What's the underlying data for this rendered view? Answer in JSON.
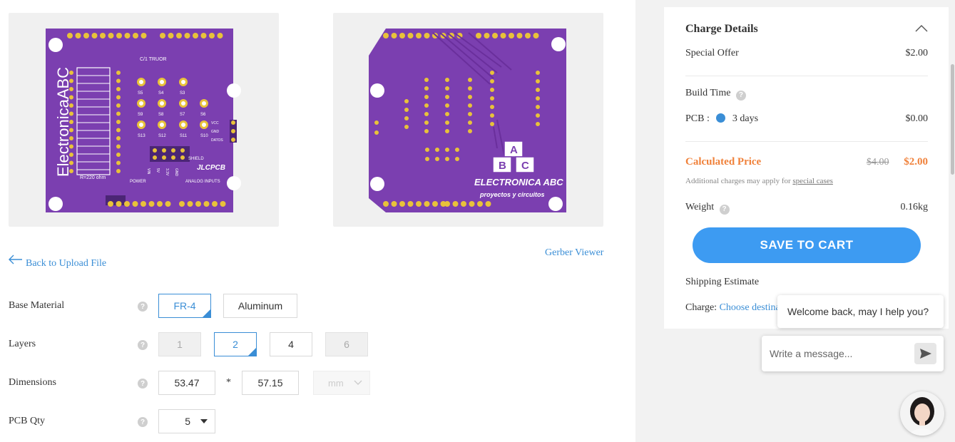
{
  "previews": {
    "top": {
      "label_vertical": "ElectronicaABC",
      "silkscreen_top": "C/1 TRUOR",
      "switch_labels": [
        "S5",
        "S4",
        "S3",
        "S9",
        "S8",
        "S7",
        "S6",
        "S13",
        "S12",
        "S11",
        "S10"
      ],
      "power_pins": [
        "VCC",
        "GND",
        "DATOS"
      ],
      "bottom_left": "R=220 ohm",
      "power_label": "POWER",
      "analog_label": "ANALOG INPUTS",
      "power_pin_labels": [
        "VIN",
        "5V",
        "3.3V",
        "GND"
      ],
      "shield_label": "SHIELD",
      "logo_text": "JLCPCB"
    },
    "bottom": {
      "blocks": [
        "A",
        "B",
        "C"
      ],
      "brand": "ELECTRONICA ABC",
      "tagline": "proyectos y circuitos"
    }
  },
  "links": {
    "back": "Back to Upload File",
    "gerber": "Gerber Viewer"
  },
  "form": {
    "base_material": {
      "label": "Base Material",
      "options": [
        "FR-4",
        "Aluminum"
      ]
    },
    "layers": {
      "label": "Layers",
      "options": [
        "1",
        "2",
        "4",
        "6"
      ]
    },
    "dimensions": {
      "label": "Dimensions",
      "width": "53.47",
      "separator": "*",
      "height": "57.15",
      "unit": "mm"
    },
    "pcb_qty": {
      "label": "PCB Qty",
      "value": "5"
    },
    "help_glyph": "?"
  },
  "charge": {
    "title": "Charge Details",
    "special_offer_label": "Special Offer",
    "special_offer_value": "$2.00",
    "build_time_label": "Build Time",
    "pcb_label": "PCB :",
    "pcb_days": "3 days",
    "pcb_value": "$0.00",
    "calc_label": "Calculated Price",
    "old_price": "$4.00",
    "new_price": "$2.00",
    "note_prefix": "Additional charges may apply for",
    "note_link": "special cases",
    "weight_label": "Weight",
    "weight_value": "0.16kg",
    "save_button": "SAVE TO CART",
    "shipping_label": "Shipping Estimate",
    "charge_label": "Charge:",
    "charge_link": "Choose destina"
  },
  "chat": {
    "welcome": "Welcome back, may I help you?",
    "placeholder": "Write a message..."
  },
  "colors": {
    "pcb_purple": "#7b3fb0",
    "accent_blue": "#3a8ed6",
    "price_orange": "#f0813a",
    "button_blue": "#3d9bf2"
  }
}
